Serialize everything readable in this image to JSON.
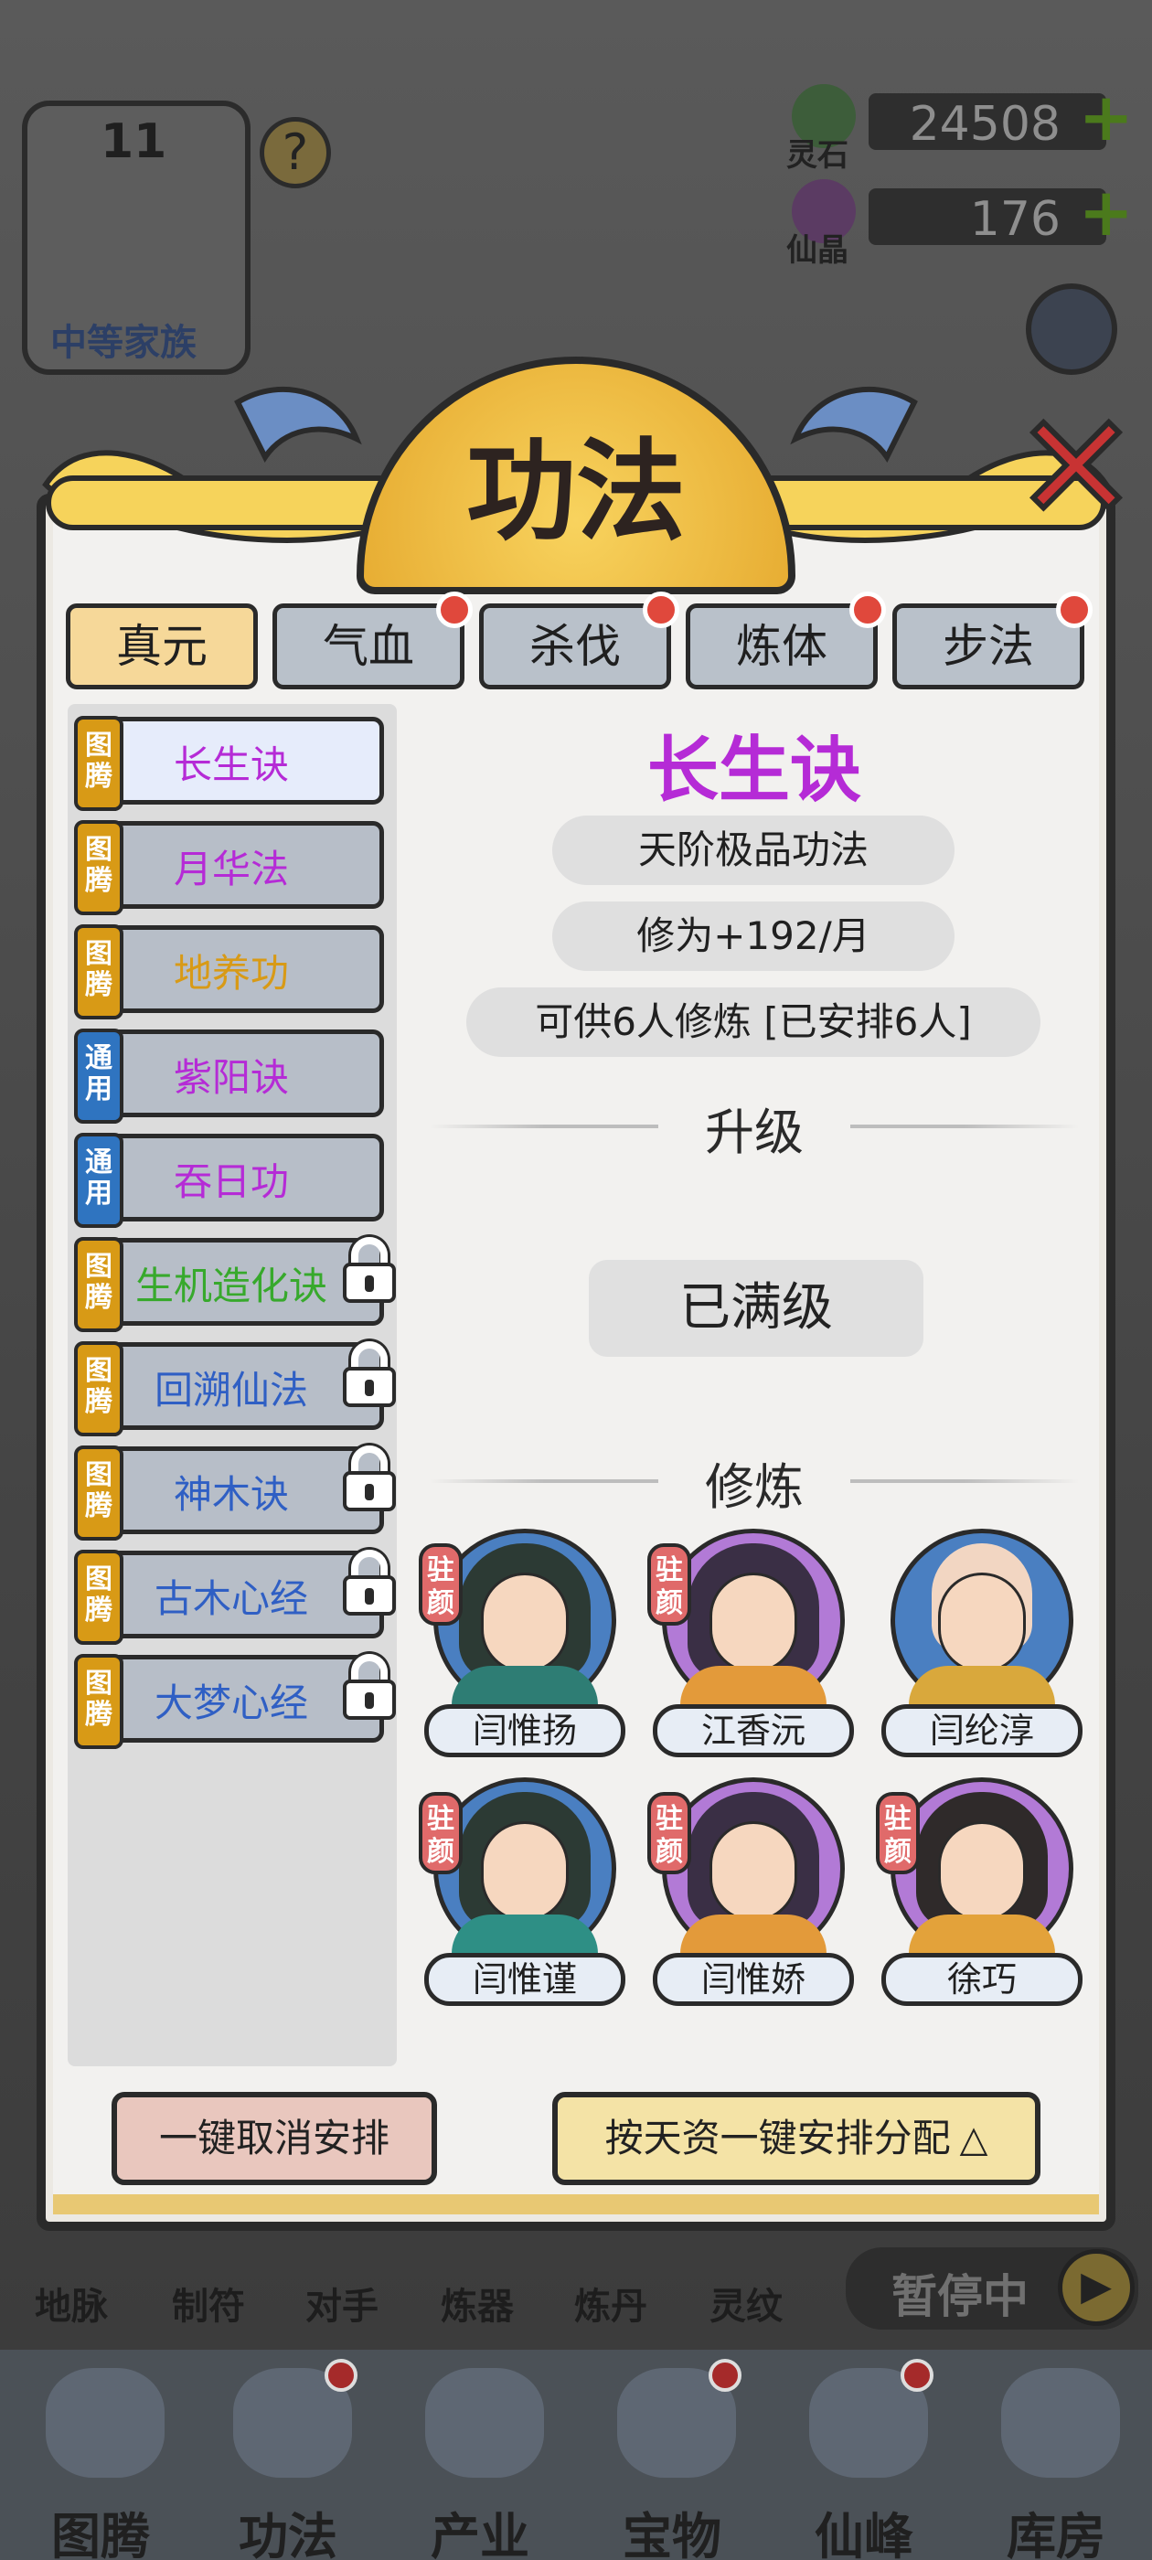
{
  "background": {
    "level": "11",
    "family": "中等家族",
    "help_icon": "question-icon",
    "resources": [
      {
        "label": "灵石",
        "value": "24508",
        "icon": "spirit-stone-icon"
      },
      {
        "label": "仙晶",
        "value": "176",
        "icon": "immortal-crystal-icon"
      }
    ],
    "bottom_small": [
      "地脉",
      "制符",
      "对手",
      "炼器",
      "炼丹",
      "灵纹"
    ],
    "pause_label": "暂停中",
    "bottom_nav": [
      {
        "label": "图腾",
        "dot": false
      },
      {
        "label": "功法",
        "dot": true
      },
      {
        "label": "产业",
        "dot": false
      },
      {
        "label": "宝物",
        "dot": true
      },
      {
        "label": "仙峰",
        "dot": true
      },
      {
        "label": "库房",
        "dot": false
      }
    ]
  },
  "dialog": {
    "title": "功法",
    "close_icon": "close-x-icon",
    "tabs": [
      {
        "label": "真元",
        "active": true,
        "dot": false
      },
      {
        "label": "气血",
        "active": false,
        "dot": true
      },
      {
        "label": "杀伐",
        "active": false,
        "dot": true
      },
      {
        "label": "炼体",
        "active": false,
        "dot": true
      },
      {
        "label": "步法",
        "active": false,
        "dot": true
      }
    ],
    "skills": [
      {
        "badge": "图腾",
        "name": "长生诀",
        "color": "#b52bd6",
        "locked": false,
        "selected": true
      },
      {
        "badge": "图腾",
        "name": "月华法",
        "color": "#b52bd6",
        "locked": false,
        "selected": false
      },
      {
        "badge": "图腾",
        "name": "地养功",
        "color": "#d89a16",
        "locked": false,
        "selected": false
      },
      {
        "badge": "通用",
        "name": "紫阳诀",
        "color": "#b52bd6",
        "locked": false,
        "selected": false
      },
      {
        "badge": "通用",
        "name": "吞日功",
        "color": "#b52bd6",
        "locked": false,
        "selected": false
      },
      {
        "badge": "图腾",
        "name": "生机造化诀",
        "color": "#37a92c",
        "locked": true,
        "selected": false
      },
      {
        "badge": "图腾",
        "name": "回溯仙法",
        "color": "#2f5fc4",
        "locked": true,
        "selected": false
      },
      {
        "badge": "图腾",
        "name": "神木诀",
        "color": "#2f5fc4",
        "locked": true,
        "selected": false
      },
      {
        "badge": "图腾",
        "name": "古木心经",
        "color": "#2f5fc4",
        "locked": true,
        "selected": false
      },
      {
        "badge": "图腾",
        "name": "大梦心经",
        "color": "#2f5fc4",
        "locked": true,
        "selected": false
      }
    ],
    "detail": {
      "name": "长生诀",
      "grade": "天阶极品功法",
      "cultivation": "修为+192/月",
      "capacity": "可供6人修炼  [已安排6人]",
      "upgrade_header": "升级",
      "maxed": "已满级",
      "practice_header": "修炼"
    },
    "disciples": [
      {
        "name": "闫惟扬",
        "tag": "驻颜",
        "ring": "#4a7fc1",
        "robe": "#2e7d74"
      },
      {
        "name": "江香沅",
        "tag": "驻颜",
        "ring": "#b27ad6",
        "robe": "#e39a3a"
      },
      {
        "name": "闫纶淳",
        "tag": "",
        "ring": "#4a7fc1",
        "robe": "#d9a83c"
      },
      {
        "name": "闫惟谨",
        "tag": "驻颜",
        "ring": "#4a7fc1",
        "robe": "#2e8f85"
      },
      {
        "name": "闫惟娇",
        "tag": "驻颜",
        "ring": "#b27ad6",
        "robe": "#e39a3a"
      },
      {
        "name": "徐巧",
        "tag": "驻颜",
        "ring": "#b27ad6",
        "robe": "#e3a23a"
      }
    ],
    "buttons": {
      "cancel_all": "一键取消安排",
      "auto_assign": "按天资一键安排分配",
      "auto_assign_icon": "triangle-up-icon"
    }
  }
}
